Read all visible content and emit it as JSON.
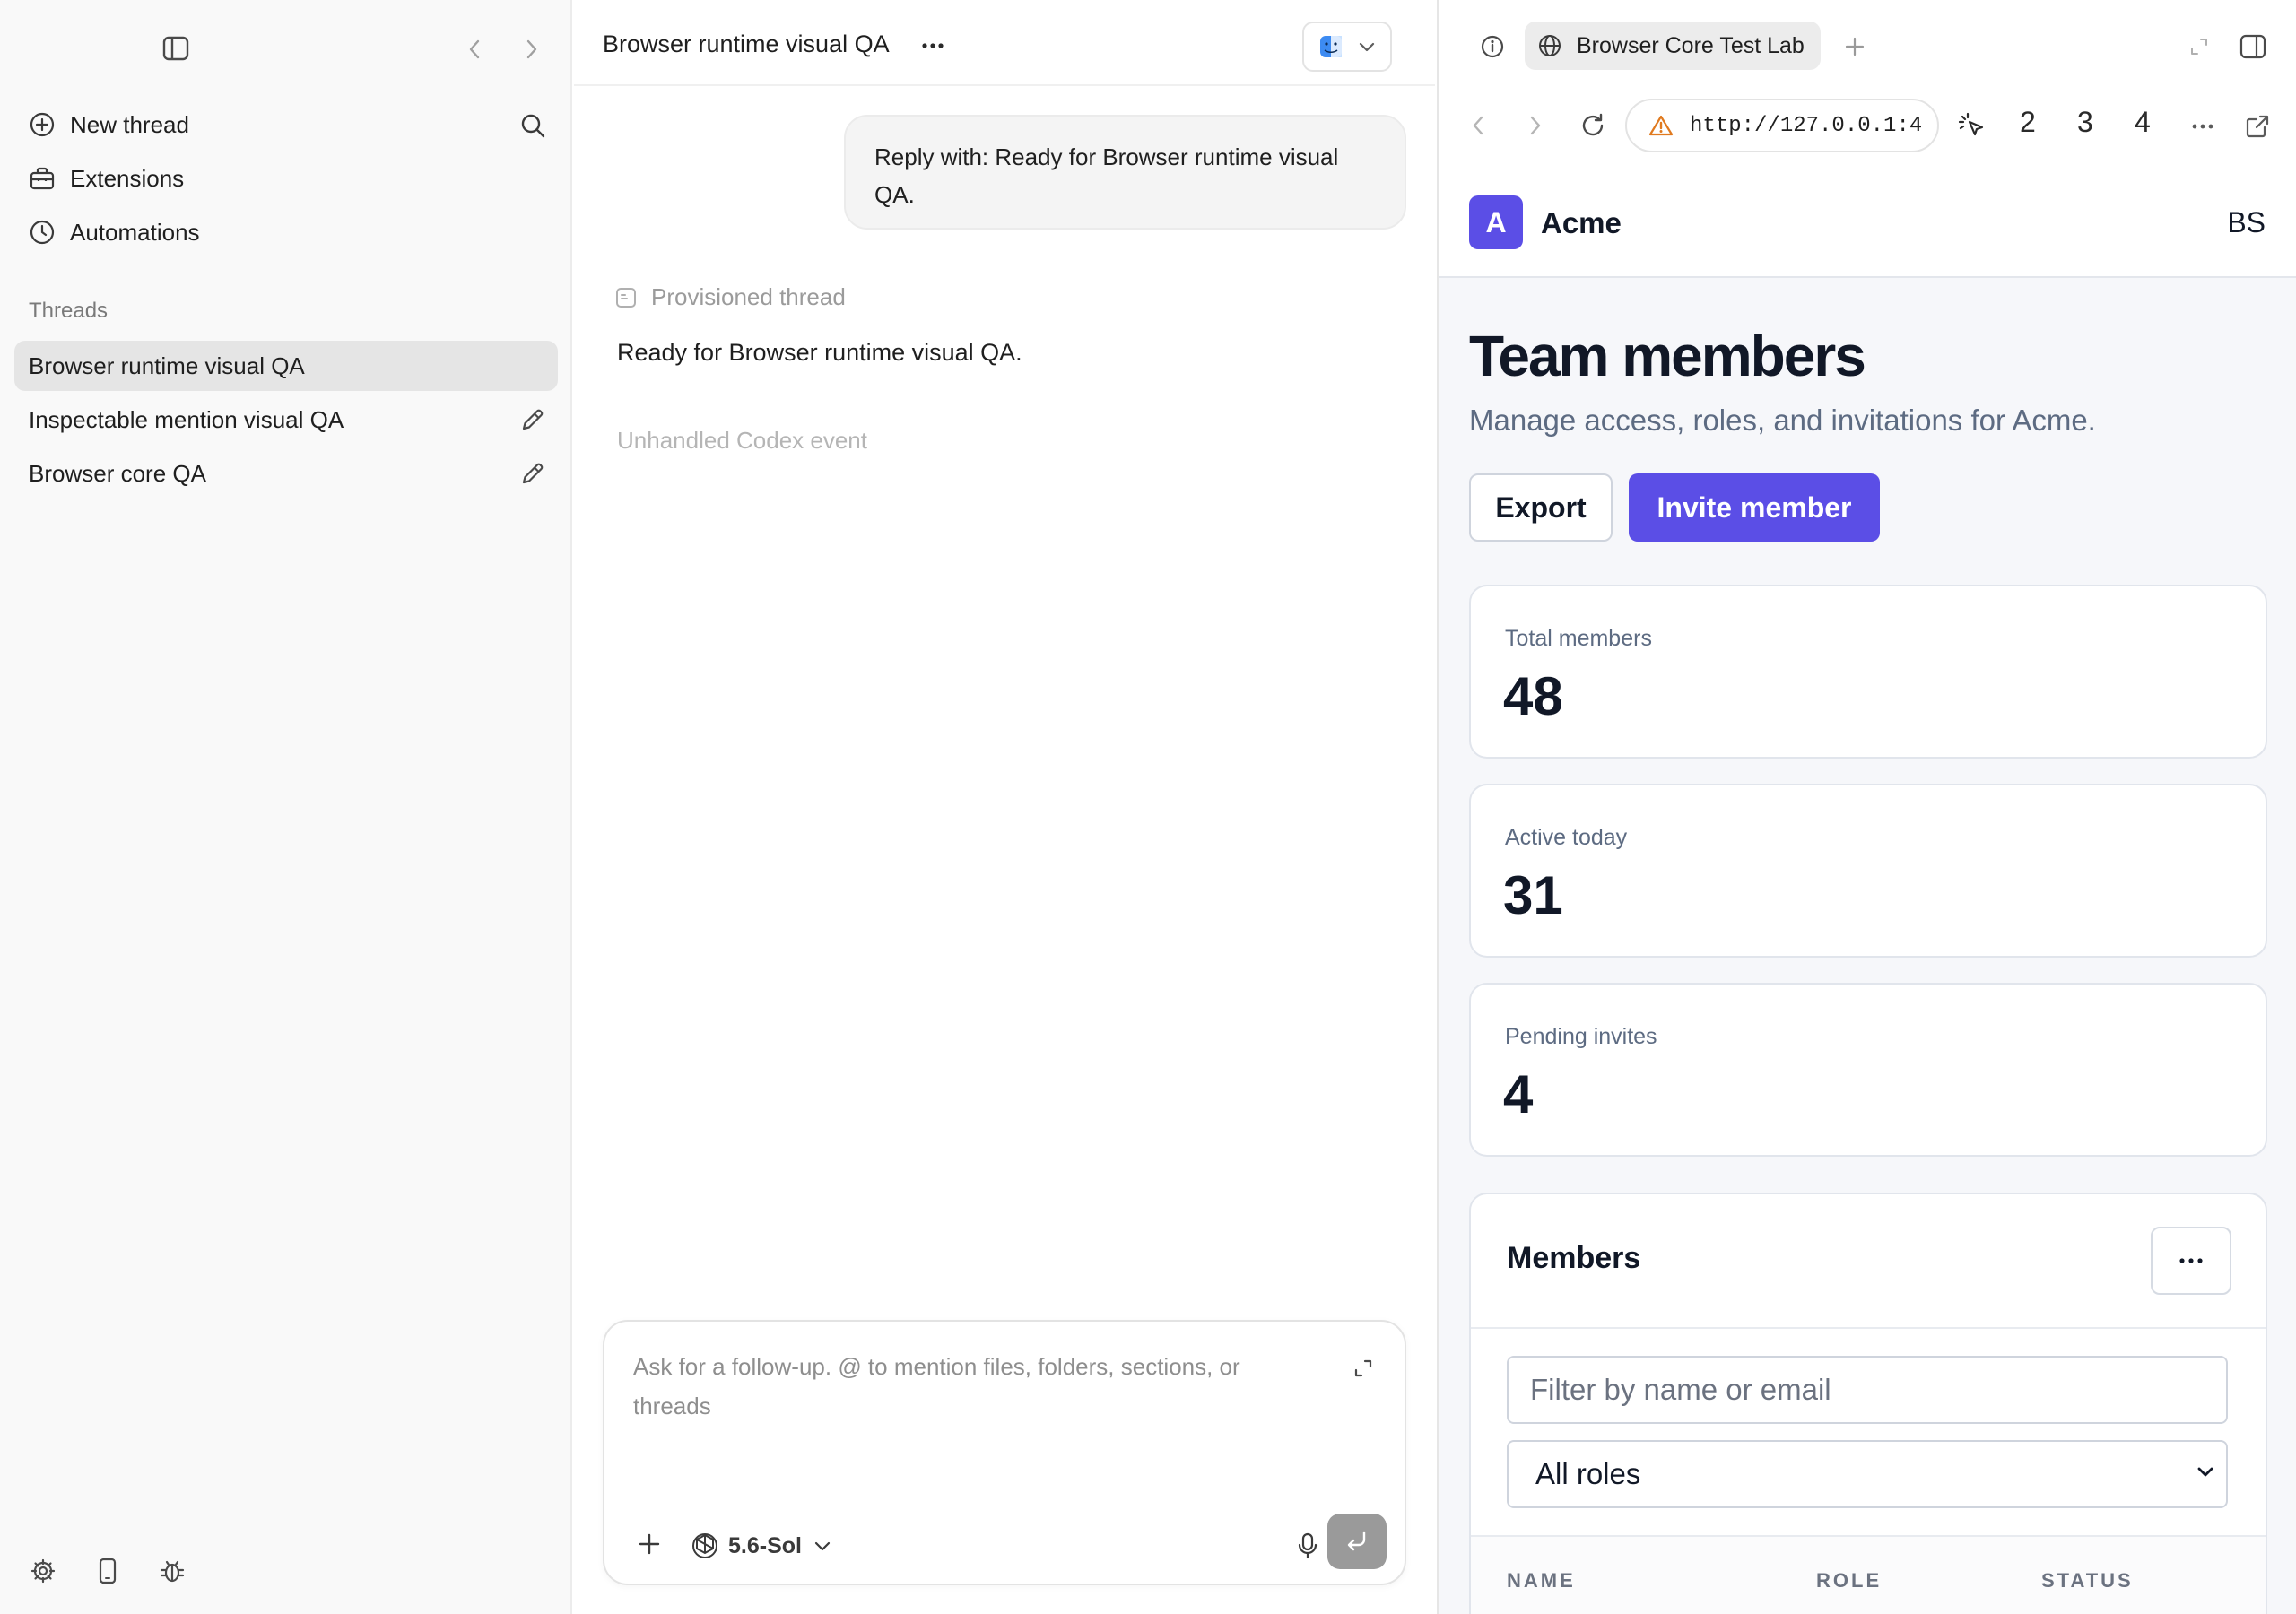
{
  "sidebar": {
    "nav": [
      {
        "label": "New thread",
        "icon": "plus-circle-icon"
      },
      {
        "label": "Extensions",
        "icon": "toolbox-icon"
      },
      {
        "label": "Automations",
        "icon": "clock-icon"
      }
    ],
    "section_label": "Threads",
    "threads": [
      {
        "label": "Browser runtime visual QA",
        "active": true
      },
      {
        "label": "Inspectable mention visual QA",
        "active": false
      },
      {
        "label": "Browser core QA",
        "active": false
      }
    ]
  },
  "chat": {
    "title": "Browser runtime visual QA",
    "user_message": "Reply with: Ready for Browser runtime visual QA.",
    "assistant_status": "Provisioned thread",
    "assistant_message": "Ready for Browser runtime visual QA.",
    "unhandled_event": "Unhandled Codex event",
    "composer": {
      "placeholder": "Ask for a follow-up. @ to mention files, folders, sections, or threads",
      "model": "5.6-Sol"
    }
  },
  "browser": {
    "tab_title": "Browser Core Test Lab",
    "url": "http://127.0.0.1:4",
    "tab_numbers": [
      "2",
      "3",
      "4"
    ],
    "page": {
      "logo_letter": "A",
      "brand": "Acme",
      "user_initials": "BS",
      "title": "Team members",
      "subtitle": "Manage access, roles, and invitations for Acme.",
      "export_label": "Export",
      "invite_label": "Invite member",
      "stats": [
        {
          "label": "Total members",
          "value": "48"
        },
        {
          "label": "Active today",
          "value": "31"
        },
        {
          "label": "Pending invites",
          "value": "4"
        }
      ],
      "members": {
        "title": "Members",
        "filter_placeholder": "Filter by name or email",
        "role_selected": "All roles",
        "columns": [
          "NAME",
          "ROLE",
          "STATUS"
        ]
      }
    }
  },
  "colors": {
    "accent": "#5b4ee6",
    "sidebar_bg": "#f9f9f9",
    "active_thread_bg": "#e5e5e5"
  }
}
